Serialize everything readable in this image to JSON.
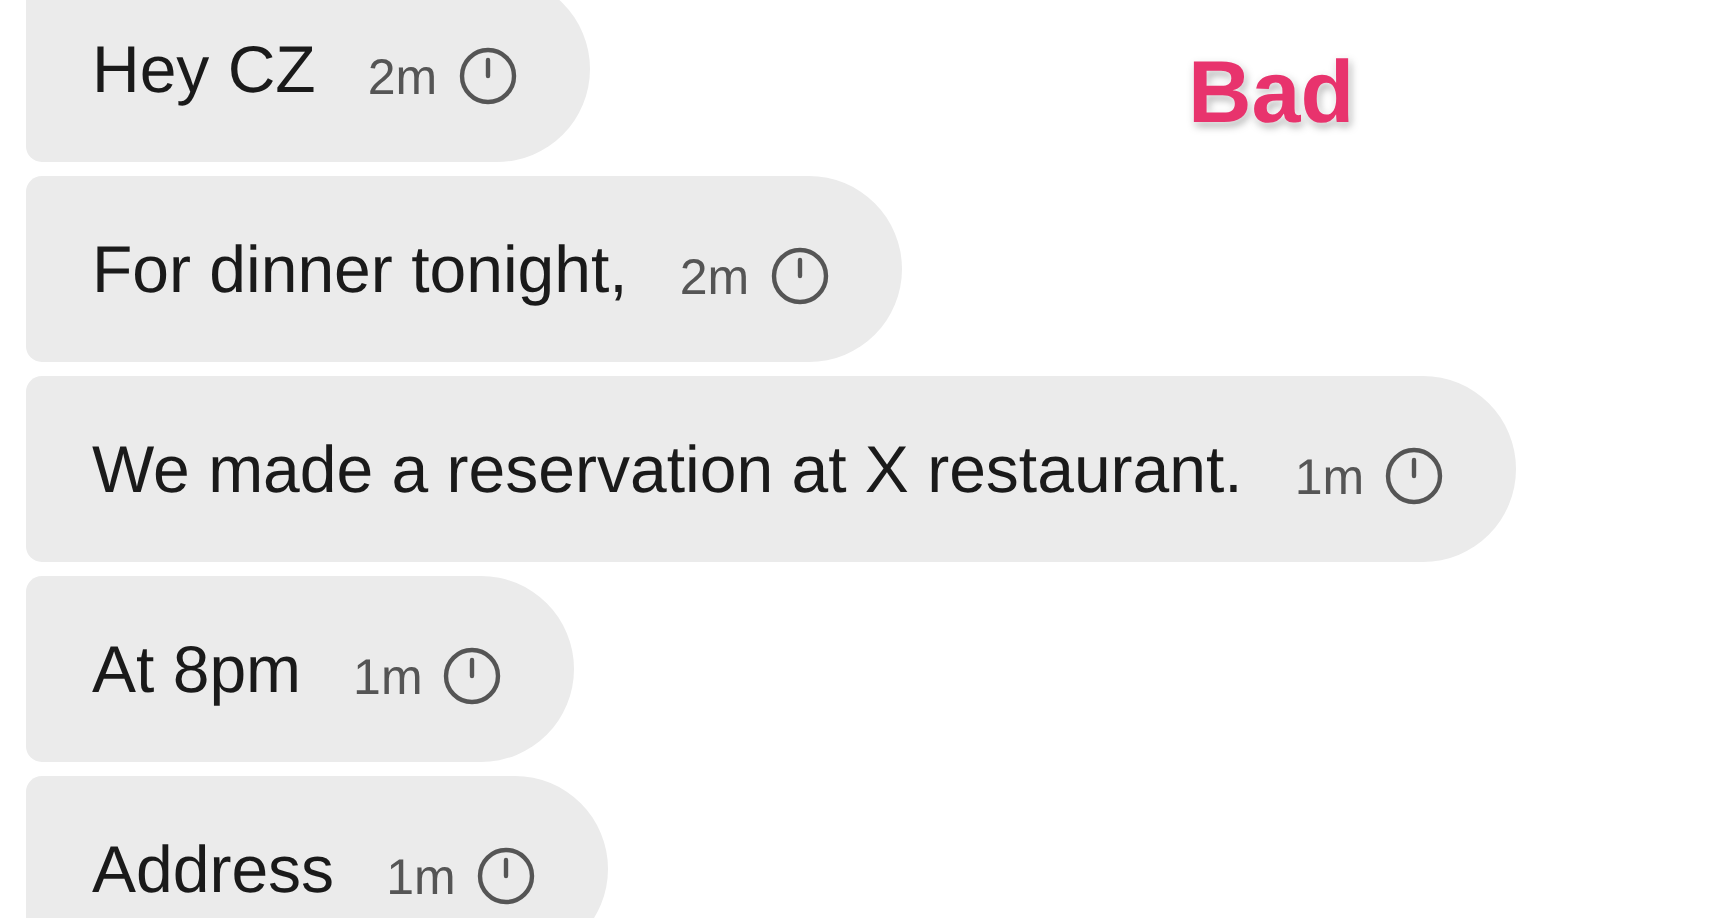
{
  "annotation": {
    "text": "Bad"
  },
  "messages": [
    {
      "text": "Hey CZ",
      "time": "2m"
    },
    {
      "text": "For dinner tonight,",
      "time": "2m"
    },
    {
      "text": "We made a reservation at X restaurant.",
      "time": "1m"
    },
    {
      "text": "At 8pm",
      "time": "1m"
    },
    {
      "text": "Address",
      "time": "1m"
    }
  ]
}
